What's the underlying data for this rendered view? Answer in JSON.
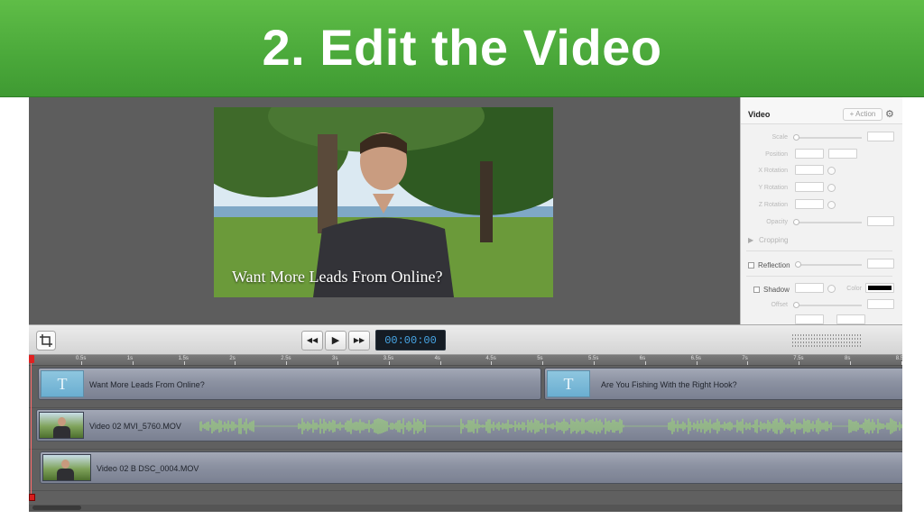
{
  "banner": {
    "title": "2. Edit the Video",
    "color": "#4aa83a"
  },
  "preview": {
    "caption": "Want More Leads From Online?"
  },
  "inspector": {
    "title": "Video",
    "action_label": "+ Action",
    "gear_icon": "⚙",
    "labels": {
      "scale": "Scale",
      "position": "Position",
      "x_rotation": "X Rotation",
      "y_rotation": "Y Rotation",
      "z_rotation": "Z Rotation",
      "opacity": "Opacity",
      "cropping": "Cropping",
      "reflection": "Reflection",
      "shadow": "Shadow",
      "color": "Color",
      "offset": "Offset"
    },
    "shadow_color": "#000000"
  },
  "toolbar": {
    "rewind_icon": "◀◀",
    "play_icon": "▶",
    "fast_forward_icon": "▶▶",
    "timecode": "00:00:00"
  },
  "ruler": {
    "ticks": [
      "0.5s",
      "1s",
      "1.5s",
      "2s",
      "2.5s",
      "3s",
      "3.5s",
      "4s",
      "4.5s",
      "5s",
      "5.5s",
      "6s",
      "6.5s",
      "7s",
      "7.5s",
      "8s",
      "8.5"
    ]
  },
  "tracks": {
    "title1": {
      "thumb": "T",
      "label": "Want More Leads From Online?"
    },
    "title2": {
      "thumb": "T",
      "label": "Are You Fishing With the Right Hook?"
    },
    "video1": {
      "label": "Video 02 MVI_5760.MOV"
    },
    "video2": {
      "label": "Video 02 B DSC_0004.MOV"
    }
  },
  "colors": {
    "waveform": "#9bd07a",
    "playhead": "#e02020",
    "timecode_text": "#47a6e6"
  }
}
